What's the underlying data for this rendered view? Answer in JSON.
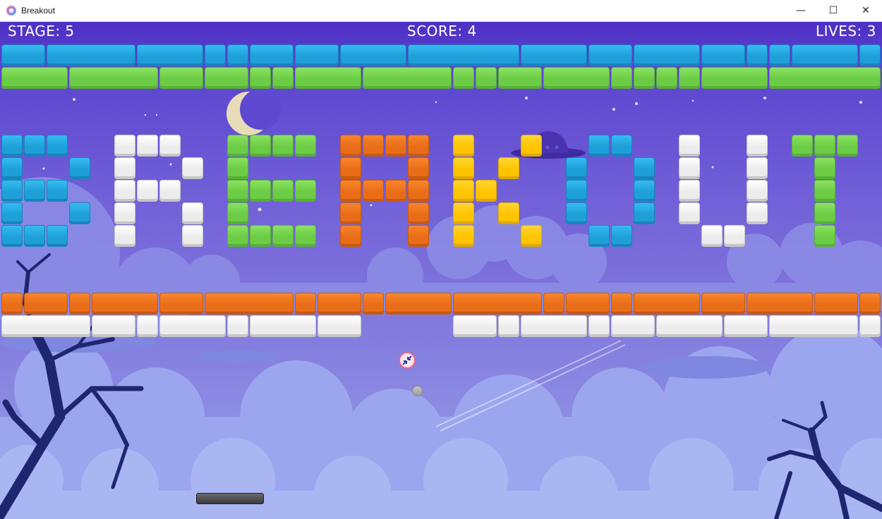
{
  "window": {
    "title": "Breakout",
    "minimize_glyph": "—",
    "maximize_glyph": "☐",
    "close_glyph": "✕"
  },
  "hud": {
    "stage": "STAGE: 5",
    "score": "SCORE: 4",
    "lives": "LIVES: 3"
  },
  "colors": {
    "blue": "#2bb0ea",
    "green": "#7ed957",
    "orange": "#f07a22",
    "white": "#f2f2f2",
    "yellow": "#ffcc1a",
    "sky_top": "#4d2fc4",
    "sky_bottom": "#9aa2ea"
  },
  "icons": {
    "app": "breakout-app-icon",
    "powerup": "shrink-arrows-icon",
    "moon": "crescent-moon",
    "ufo": "ufo-silhouette"
  }
}
